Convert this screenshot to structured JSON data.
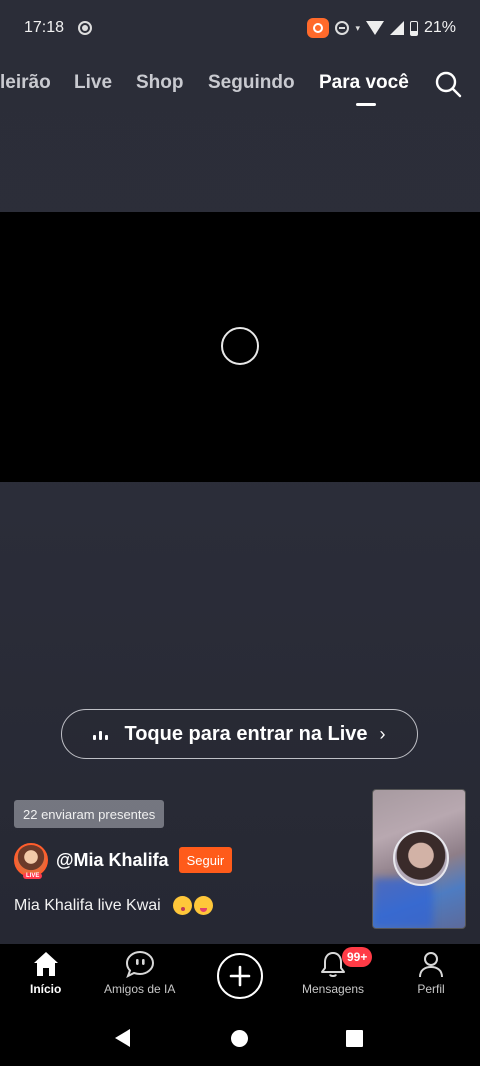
{
  "status_bar": {
    "time": "17:18",
    "battery": "21%"
  },
  "top_nav": {
    "tabs": [
      {
        "label": "leirão"
      },
      {
        "label": "Live"
      },
      {
        "label": "Shop"
      },
      {
        "label": "Seguindo"
      },
      {
        "label": "Para você",
        "active": true
      }
    ],
    "search_icon": "search-icon"
  },
  "video": {
    "state_icon": "loading-spinner"
  },
  "live_prompt": {
    "label": "Toque para entrar na Live",
    "chevron": "›"
  },
  "gifts_badge": "22 enviaram presentes",
  "streamer": {
    "username": "@Mia Khalifa",
    "live_tag": "LIVE",
    "follow_label": "Seguir",
    "caption": "Mia Khalifa live Kwai"
  },
  "bottom_nav": {
    "items": [
      {
        "label": "Início",
        "icon": "home-icon",
        "active": true
      },
      {
        "label": "Amigos de IA",
        "icon": "chat-bubble-icon"
      },
      {
        "label": "",
        "icon": "plus-icon"
      },
      {
        "label": "Mensagens",
        "icon": "bell-icon",
        "badge": "99+"
      },
      {
        "label": "Perfil",
        "icon": "person-icon"
      }
    ]
  },
  "colors": {
    "accent": "#ff5b1a",
    "badge": "#ff3b46",
    "background": "#2a2c38"
  }
}
